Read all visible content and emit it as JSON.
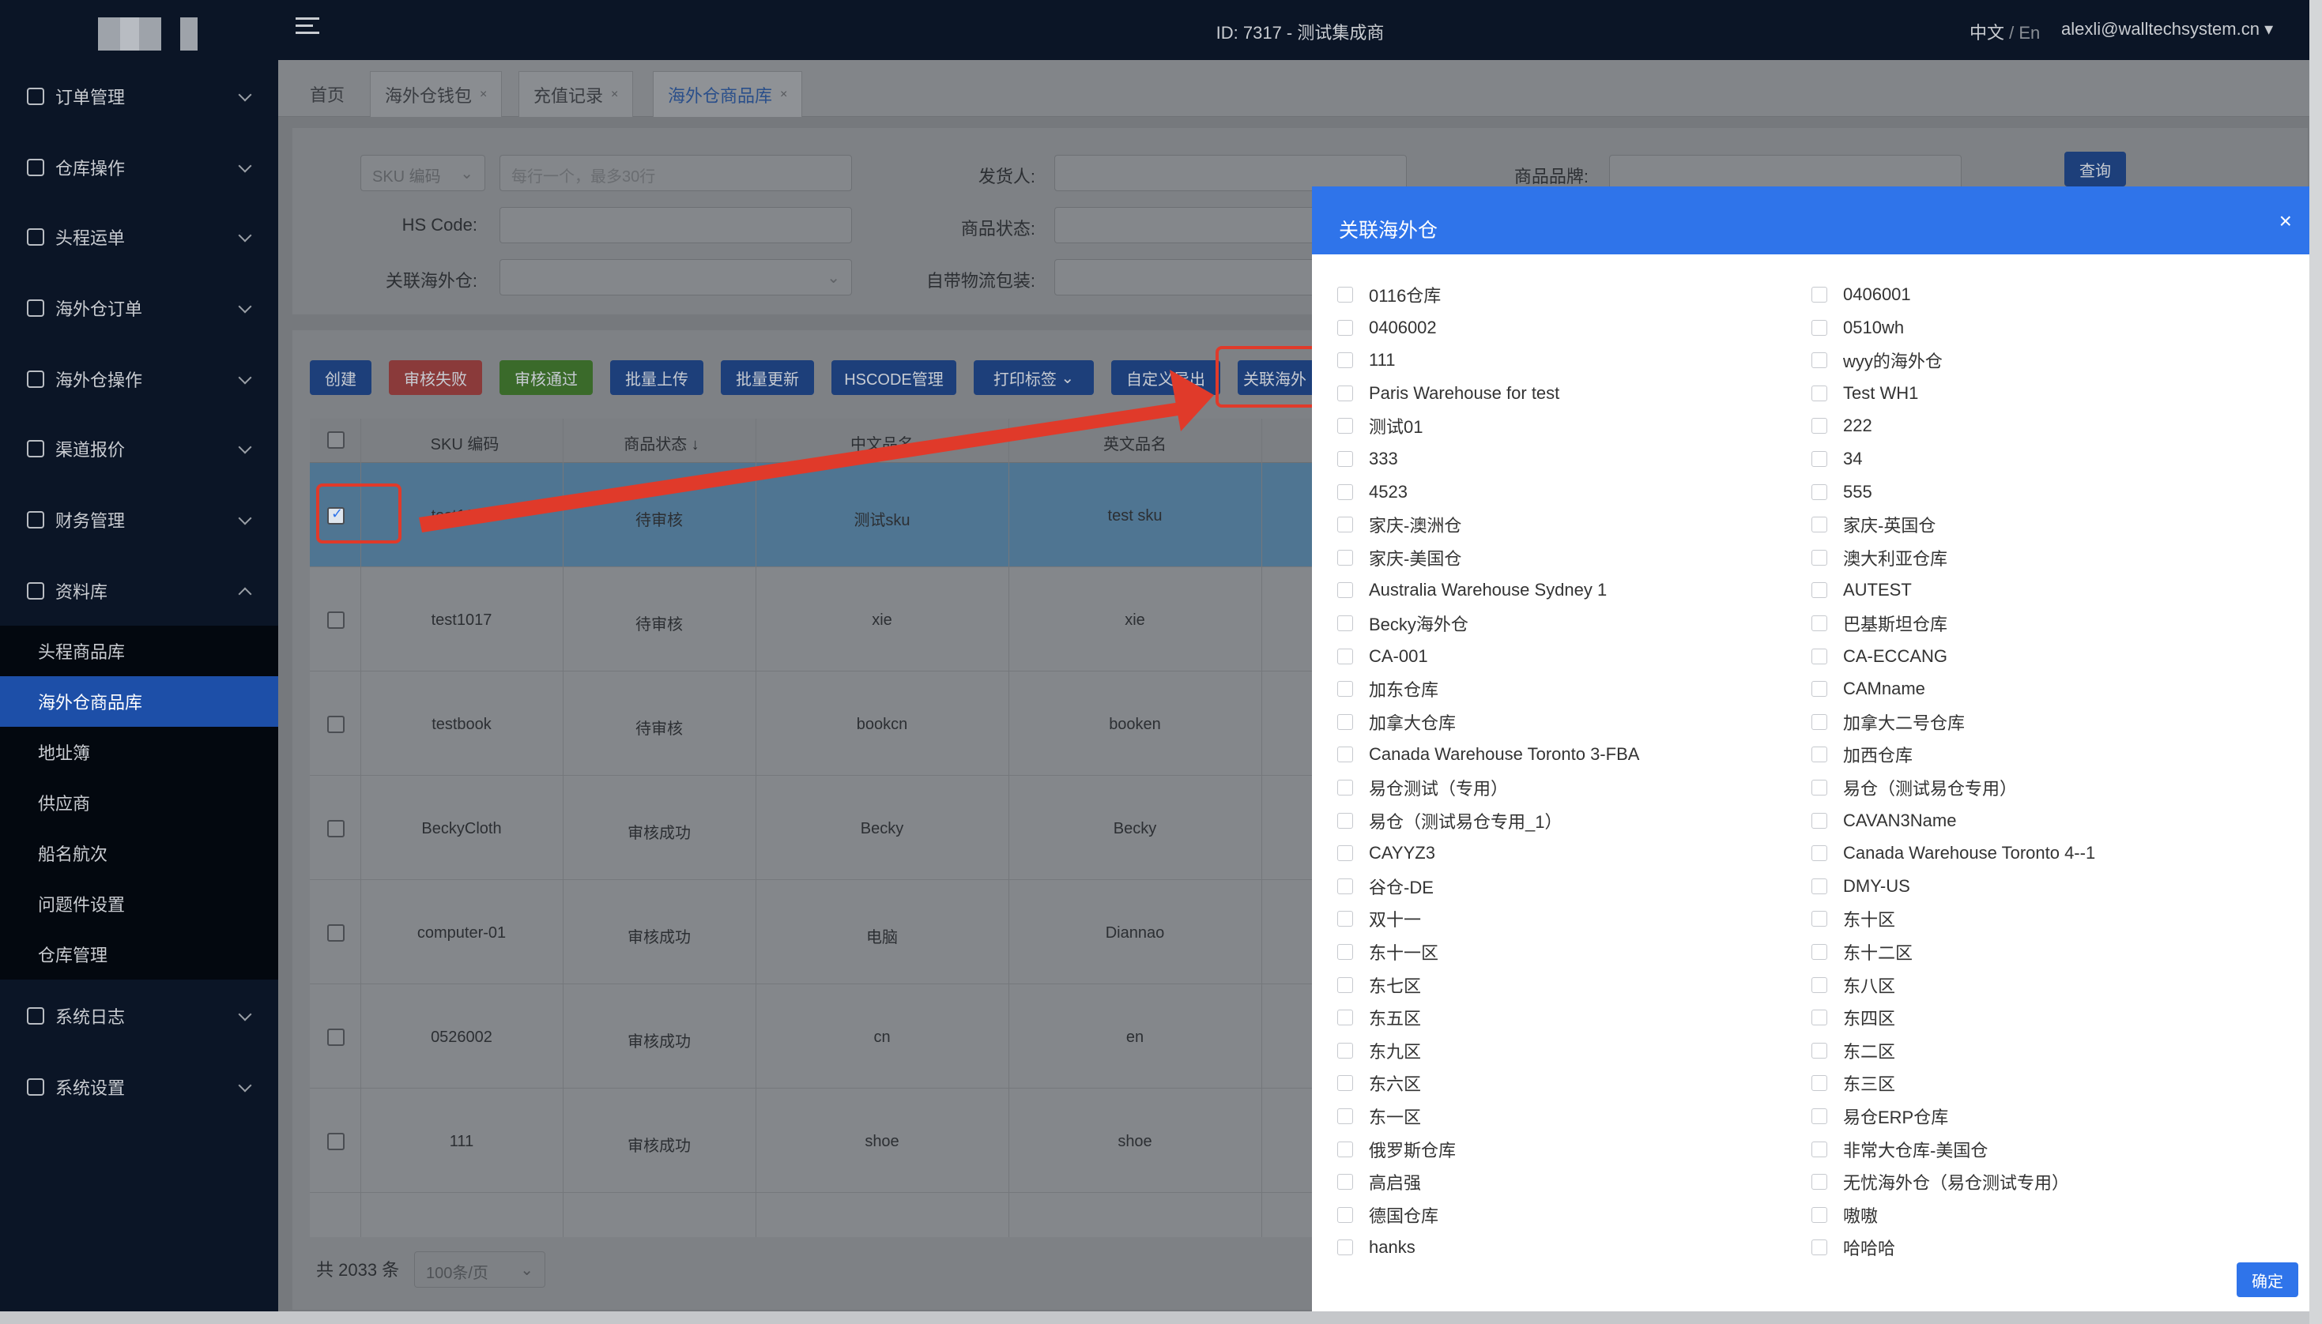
{
  "topbar": {
    "center": "ID: 7317 - 测试集成商",
    "lang_zh": "中文",
    "lang_sep": " / ",
    "lang_en": "En",
    "user": "alexli@walltechsystem.cn"
  },
  "sidebar": {
    "items": [
      {
        "label": "订单管理",
        "icon": "order-icon"
      },
      {
        "label": "仓库操作",
        "icon": "warehouse-icon"
      },
      {
        "label": "头程运单",
        "icon": "waybill-icon"
      },
      {
        "label": "海外仓订单",
        "icon": "overseas-order-icon"
      },
      {
        "label": "海外仓操作",
        "icon": "overseas-operation-icon"
      },
      {
        "label": "渠道报价",
        "icon": "channel-icon"
      },
      {
        "label": "财务管理",
        "icon": "finance-icon"
      },
      {
        "label": "资料库",
        "icon": "database-icon"
      },
      {
        "label": "系统日志",
        "icon": "log-icon"
      },
      {
        "label": "系统设置",
        "icon": "settings-icon"
      }
    ],
    "subitems": [
      "头程商品库",
      "海外仓商品库",
      "地址簿",
      "供应商",
      "船名航次",
      "问题件设置",
      "仓库管理"
    ]
  },
  "tabs": [
    {
      "label": "首页"
    },
    {
      "label": "海外仓钱包",
      "close": "×"
    },
    {
      "label": "充值记录",
      "close": "×"
    },
    {
      "label": "海外仓商品库",
      "close": "×"
    }
  ],
  "filters": {
    "sku_select": "SKU 编码",
    "sku_placeholder": "每行一个，最多30行",
    "shipper_label": "发货人:",
    "brand_label": "商品品牌:",
    "query": "查询",
    "hs_label": "HS Code:",
    "status_label": "商品状态:",
    "warehouse_label": "关联海外仓:",
    "pack_label": "自带物流包装:"
  },
  "toolbar": {
    "create": "创建",
    "reject": "审核失败",
    "approve": "审核通过",
    "batch_upload": "批量上传",
    "batch_update": "批量更新",
    "hscode": "HSCODE管理",
    "print": "打印标签",
    "export": "自定义导出",
    "link_wh": "关联海外"
  },
  "table": {
    "headers": {
      "sku": "SKU 编码",
      "status": "商品状态",
      "cn": "中文品名",
      "en": "英文品名"
    },
    "rows": [
      {
        "sku": "test1016",
        "status": "待审核",
        "cn": "测试sku",
        "en": "test sku"
      },
      {
        "sku": "test1017",
        "status": "待审核",
        "cn": "xie",
        "en": "xie"
      },
      {
        "sku": "testbook",
        "status": "待审核",
        "cn": "bookcn",
        "en": "booken"
      },
      {
        "sku": "BeckyCloth",
        "status": "审核成功",
        "cn": "Becky",
        "en": "Becky"
      },
      {
        "sku": "computer-01",
        "status": "审核成功",
        "cn": "电脑",
        "en": "Diannao"
      },
      {
        "sku": "0526002",
        "status": "审核成功",
        "cn": "cn",
        "en": "en"
      },
      {
        "sku": "111",
        "status": "审核成功",
        "cn": "shoe",
        "en": "shoe"
      }
    ]
  },
  "pager": {
    "total": "共 2033 条",
    "size": "100条/页"
  },
  "dialog": {
    "title": "关联海外仓",
    "close": "×",
    "ok": "确定",
    "options": [
      "0116仓库",
      "0406001",
      "0406002",
      "0510wh",
      "111",
      "wyy的海外仓",
      "Paris Warehouse for test",
      "Test WH1",
      "测试01",
      "222",
      "333",
      "34",
      "4523",
      "555",
      "家庆-澳洲仓",
      "家庆-英国仓",
      "家庆-美国仓",
      "澳大利亚仓库",
      "Australia Warehouse Sydney 1",
      "AUTEST",
      "Becky海外仓",
      "巴基斯坦仓库",
      "CA-001",
      "CA-ECCANG",
      "加东仓库",
      "CAMname",
      "加拿大仓库",
      "加拿大二号仓库",
      "Canada Warehouse Toronto 3-FBA",
      "加西仓库",
      "易仓测试（专用）",
      "易仓（测试易仓专用）",
      "易仓（测试易仓专用_1）",
      "CAVAN3Name",
      "CAYYZ3",
      "Canada Warehouse Toronto 4--1",
      "谷仓-DE",
      "DMY-US",
      "双十一",
      "东十区",
      "东十一区",
      "东十二区",
      "东七区",
      "东八区",
      "东五区",
      "东四区",
      "东九区",
      "东二区",
      "东六区",
      "东三区",
      "东一区",
      "易仓ERP仓库",
      "俄罗斯仓库",
      "非常大仓库-美国仓",
      "高启强",
      "无忧海外仓（易仓测试专用）",
      "德国仓库",
      "嗷嗷",
      "hanks",
      "哈哈哈"
    ]
  },
  "colors": {
    "accent": "#2f74ea",
    "annotation": "#e03a2a",
    "sidebar": "#0b1526"
  }
}
